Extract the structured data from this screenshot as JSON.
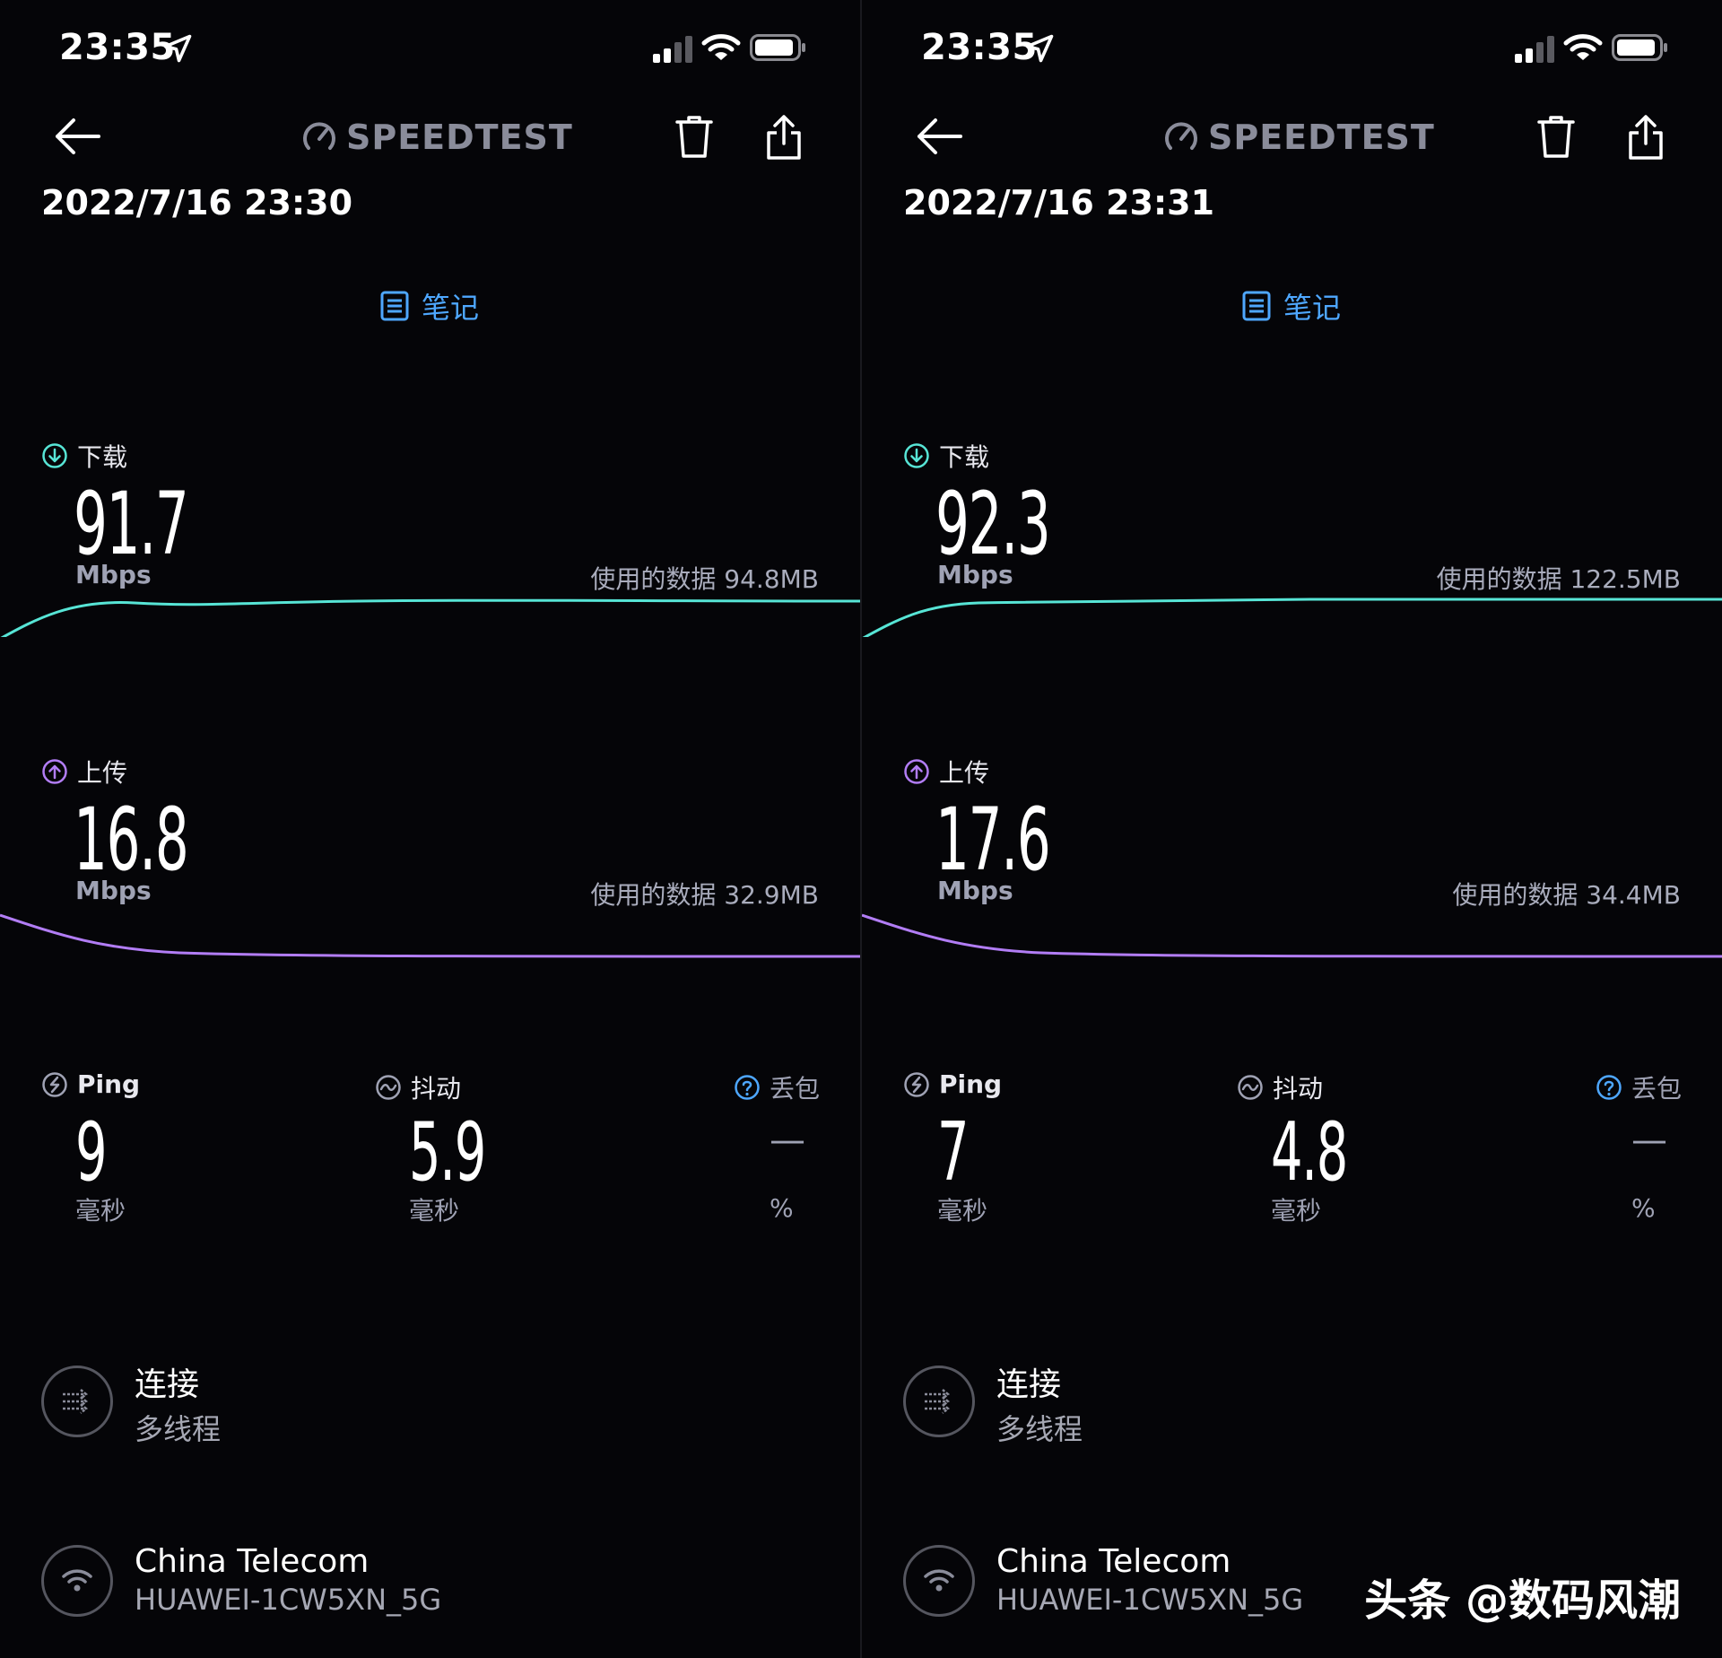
{
  "colors": {
    "accent_blue": "#4ea7ff",
    "download_line": "#57e5d6",
    "upload_line": "#b27df5",
    "muted_text": "#9fa2b4"
  },
  "brand": "SPEEDTEST",
  "watermark": "头条 @数码风潮",
  "screens": [
    {
      "status_time": "23:35",
      "datetime": "2022/7/16 23:30",
      "notes_label": "笔记",
      "download": {
        "label": "下载",
        "value": "91.7",
        "unit": "Mbps",
        "data_used": "使用的数据 94.8MB"
      },
      "upload": {
        "label": "上传",
        "value": "16.8",
        "unit": "Mbps",
        "data_used": "使用的数据 32.9MB"
      },
      "ping": {
        "label": "Ping",
        "value": "9",
        "unit": "毫秒"
      },
      "jitter": {
        "label": "抖动",
        "value": "5.9",
        "unit": "毫秒"
      },
      "packet_loss": {
        "label": "丢包",
        "value": "—",
        "unit": "%"
      },
      "connection": {
        "title": "连接",
        "subtitle": "多线程"
      },
      "network": {
        "title": "China Telecom",
        "subtitle": "HUAWEI-1CW5XN_5G"
      }
    },
    {
      "status_time": "23:35",
      "datetime": "2022/7/16 23:31",
      "notes_label": "笔记",
      "download": {
        "label": "下载",
        "value": "92.3",
        "unit": "Mbps",
        "data_used": "使用的数据 122.5MB"
      },
      "upload": {
        "label": "上传",
        "value": "17.6",
        "unit": "Mbps",
        "data_used": "使用的数据 34.4MB"
      },
      "ping": {
        "label": "Ping",
        "value": "7",
        "unit": "毫秒"
      },
      "jitter": {
        "label": "抖动",
        "value": "4.8",
        "unit": "毫秒"
      },
      "packet_loss": {
        "label": "丢包",
        "value": "—",
        "unit": "%"
      },
      "connection": {
        "title": "连接",
        "subtitle": "多线程"
      },
      "network": {
        "title": "China Telecom",
        "subtitle": "HUAWEI-1CW5XN_5G"
      }
    }
  ]
}
